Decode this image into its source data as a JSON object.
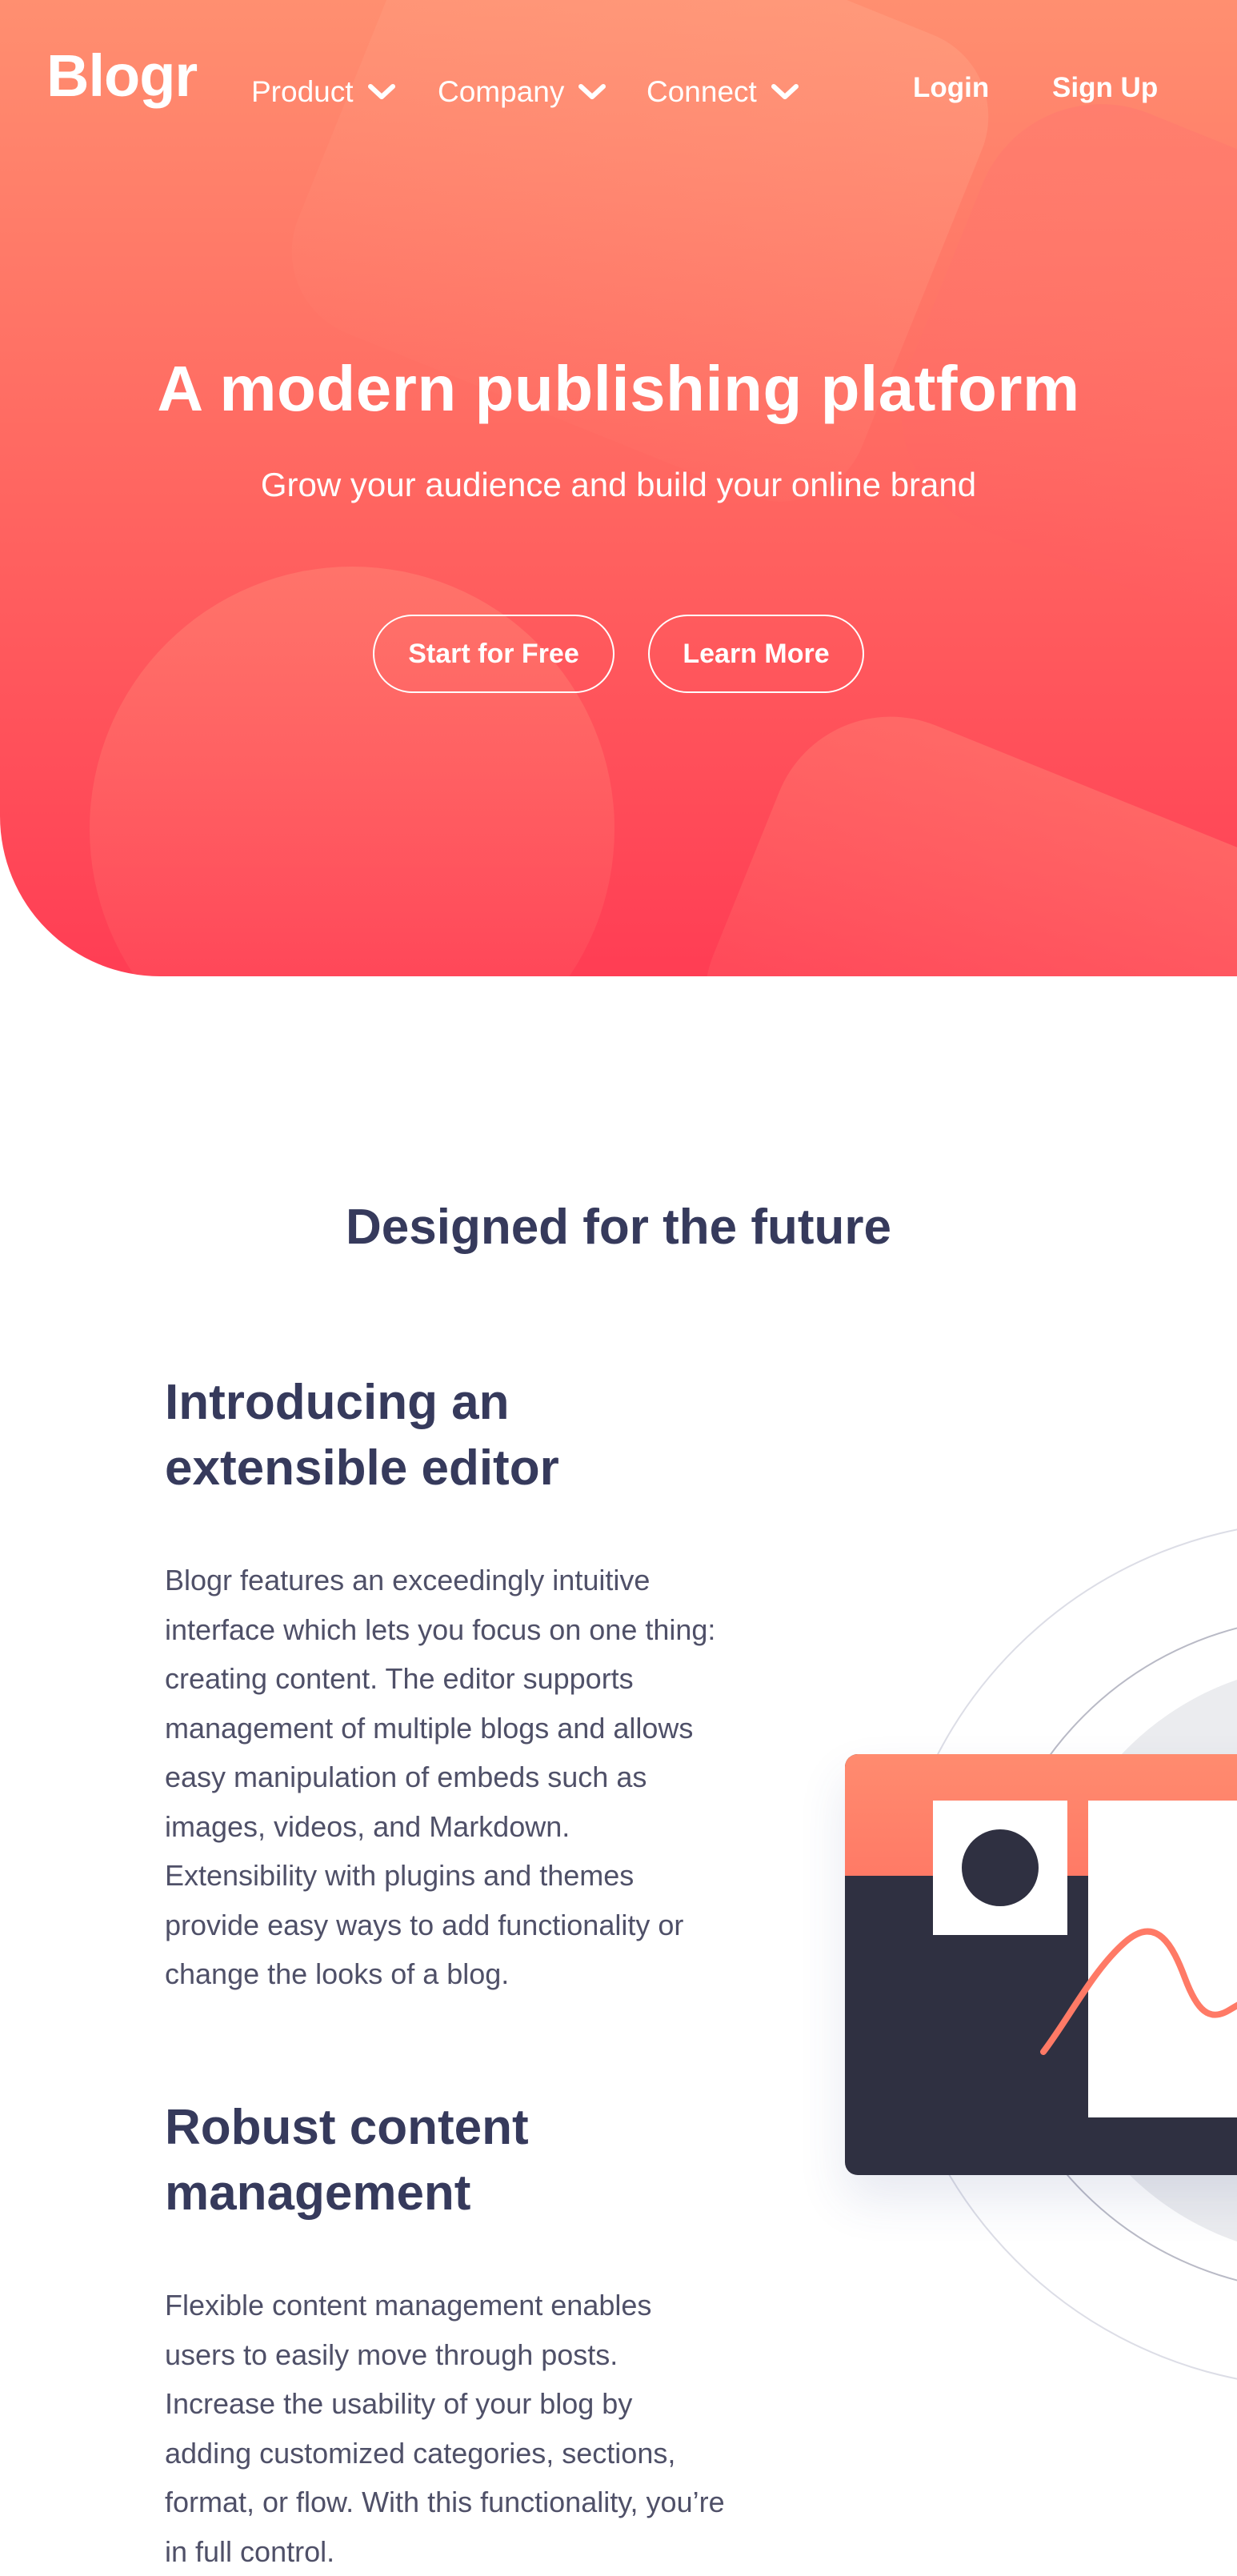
{
  "nav": {
    "logo": "Blogr",
    "menus": [
      {
        "label": "Product"
      },
      {
        "label": "Company"
      },
      {
        "label": "Connect"
      }
    ],
    "login_label": "Login",
    "signup_label": "Sign Up"
  },
  "hero": {
    "title": "A modern publishing platform",
    "subtitle": "Grow your audience and build your online brand",
    "start_label": "Start for Free",
    "learn_label": "Learn More"
  },
  "features": {
    "section_title": "Designed for the future",
    "items": [
      {
        "heading": "Introducing an extensible editor",
        "body": "Blogr features an exceedingly intuitive interface which lets you focus on one thing: creating content. The editor supports management of multiple blogs and allows easy manipulation of embeds such as images, videos, and Markdown. Extensibility with plugins and themes provide easy ways to add functionality or change the looks of a blog."
      },
      {
        "heading": "Robust content management",
        "body": "Flexible content management enables users to easily move through posts. Increase the usability of your blog by adding customized categories, sections, format, or flow. With this functionality, you’re in full control."
      }
    ]
  },
  "colors": {
    "hero_gradient_top": "#ff8f70",
    "hero_gradient_bottom": "#ff3d54",
    "heading_text": "#363a5c",
    "body_text": "#4f5068",
    "illustration_dark": "#2f3041"
  },
  "icons": {
    "menu_arrow": "chevron-down-icon"
  }
}
